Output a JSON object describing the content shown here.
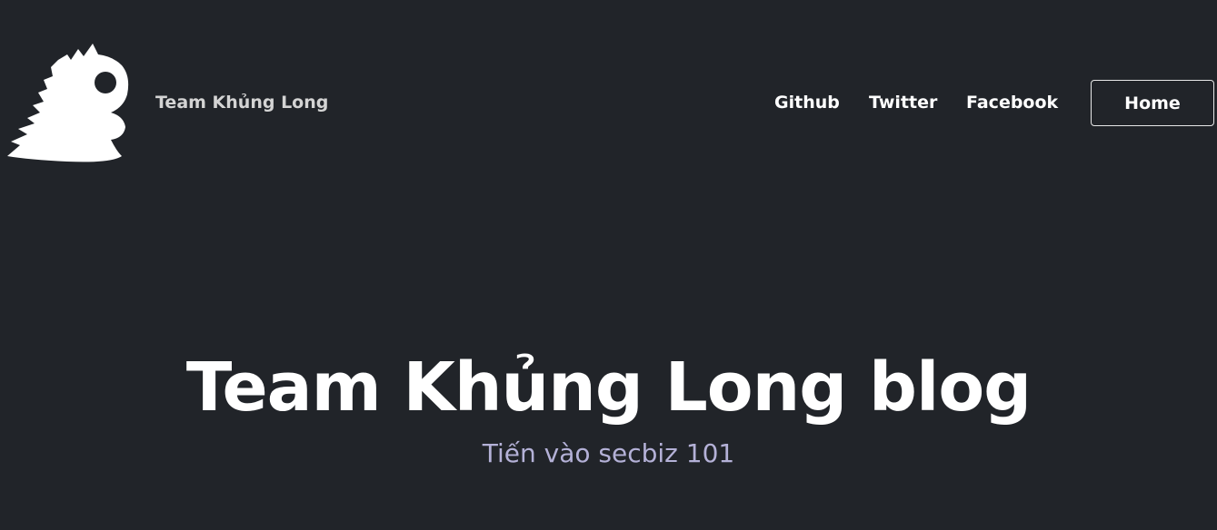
{
  "colors": {
    "background": "#212429",
    "text_primary": "#ffffff",
    "brand_text": "#d4d4d4",
    "subtitle": "#b4b1d7",
    "button_border": "#e8e8e8"
  },
  "header": {
    "logo_icon": "dinosaur-logo-icon",
    "brand": "Team Khủng Long",
    "nav": {
      "github": "Github",
      "twitter": "Twitter",
      "facebook": "Facebook"
    },
    "home_button": "Home"
  },
  "hero": {
    "title": "Team Khủng Long blog",
    "subtitle": "Tiến vào secbiz 101"
  }
}
